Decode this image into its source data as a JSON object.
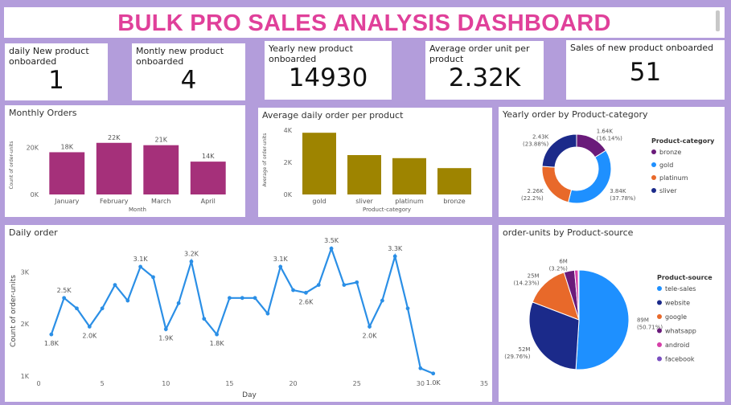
{
  "header": {
    "title": "BULK PRO SALES ANALYSIS DASHBOARD"
  },
  "kpis": [
    {
      "label": "daily New product onboarded",
      "value": "1"
    },
    {
      "label": "Montly new product onboarded",
      "value": "4"
    },
    {
      "label": "Yearly new product onboarded",
      "value": "14930"
    },
    {
      "label": "Average order unit per product",
      "value": "2.32K"
    },
    {
      "label": "Sales of new product onboarded",
      "value": "51"
    }
  ],
  "colors": {
    "title": "#e0409a",
    "monthly_bar": "#a5307a",
    "product_bar": "#9e8400",
    "line": "#2b8fe6",
    "bronze": "#6a1b7a",
    "gold": "#1e90ff",
    "platinum": "#e8692a",
    "sliver": "#1b2a8a",
    "tele-sales": "#1e90ff",
    "website": "#1b2a8a",
    "google": "#e8692a",
    "whatsapp": "#6a1b7a",
    "android": "#d63fa8",
    "facebook": "#7a4fc0"
  },
  "chart_data": [
    {
      "id": "monthly_orders",
      "type": "bar",
      "title": "Monthly Orders",
      "xlabel": "Month",
      "ylabel": "Count of order-units",
      "categories": [
        "January",
        "February",
        "March",
        "April"
      ],
      "values": [
        18000,
        22000,
        21000,
        14000
      ],
      "data_labels": [
        "18K",
        "22K",
        "21K",
        "14K"
      ],
      "yticks": [
        {
          "value": 0,
          "label": "0K"
        },
        {
          "value": 20000,
          "label": "20K"
        }
      ],
      "ylim": [
        0,
        25000
      ]
    },
    {
      "id": "avg_daily_order",
      "type": "bar",
      "title": "Average daily order per product",
      "xlabel": "Product-category",
      "ylabel": "Average of order-units",
      "categories": [
        "gold",
        "sliver",
        "platinum",
        "bronze"
      ],
      "values": [
        3840,
        2450,
        2260,
        1640
      ],
      "yticks": [
        {
          "value": 0,
          "label": "0K"
        },
        {
          "value": 2000,
          "label": "2K"
        },
        {
          "value": 4000,
          "label": "4K"
        }
      ],
      "ylim": [
        0,
        4300
      ]
    },
    {
      "id": "yearly_order_category",
      "type": "pie",
      "donut": true,
      "title": "Yearly order by Product-category",
      "legend_title": "Product-category",
      "legend_position": "right",
      "slices": [
        {
          "name": "bronze",
          "value": 1640,
          "label": "1.64K (16.14%)"
        },
        {
          "name": "gold",
          "value": 3840,
          "label": "3.84K (37.78%)"
        },
        {
          "name": "platinum",
          "value": 2260,
          "label": "2.26K (22.2%)"
        },
        {
          "name": "sliver",
          "value": 2430,
          "label": "2.43K (23.88%)"
        }
      ]
    },
    {
      "id": "daily_order",
      "type": "line",
      "title": "Daily order",
      "xlabel": "Day",
      "ylabel": "Count of order-units",
      "x": [
        1,
        2,
        3,
        4,
        5,
        6,
        7,
        8,
        9,
        10,
        11,
        12,
        13,
        14,
        15,
        16,
        17,
        18,
        19,
        20,
        21,
        22,
        23,
        24,
        25,
        26,
        27,
        28,
        29,
        30,
        31
      ],
      "y": [
        1800,
        2500,
        2300,
        1950,
        2300,
        2750,
        2450,
        3100,
        2900,
        1900,
        2400,
        3200,
        2100,
        1800,
        2500,
        2500,
        2500,
        2200,
        3100,
        2650,
        2600,
        2750,
        3450,
        2750,
        2800,
        1950,
        2450,
        3300,
        2300,
        1150,
        1050
      ],
      "data_labels": [
        {
          "index": 0,
          "text": "1.8K"
        },
        {
          "index": 1,
          "text": "2.5K"
        },
        {
          "index": 3,
          "text": "2.0K"
        },
        {
          "index": 7,
          "text": "3.1K"
        },
        {
          "index": 9,
          "text": "1.9K"
        },
        {
          "index": 11,
          "text": "3.2K"
        },
        {
          "index": 13,
          "text": "1.8K"
        },
        {
          "index": 18,
          "text": "3.1K"
        },
        {
          "index": 20,
          "text": "2.6K"
        },
        {
          "index": 22,
          "text": "3.5K"
        },
        {
          "index": 25,
          "text": "2.0K"
        },
        {
          "index": 27,
          "text": "3.3K"
        },
        {
          "index": 30,
          "text": "1.0K"
        }
      ],
      "xticks": [
        0,
        5,
        10,
        15,
        20,
        25,
        30,
        35
      ],
      "yticks": [
        {
          "value": 1000,
          "label": "1K"
        },
        {
          "value": 2000,
          "label": "2K"
        },
        {
          "value": 3000,
          "label": "3K"
        }
      ],
      "xlim": [
        0,
        35
      ],
      "ylim": [
        1000,
        3500
      ]
    },
    {
      "id": "order_units_source",
      "type": "pie",
      "title": "order-units by Product-source",
      "legend_title": "Product-source",
      "legend_position": "right",
      "slices": [
        {
          "name": "tele-sales",
          "value": 89,
          "label": "89M (50.71%)"
        },
        {
          "name": "website",
          "value": 52,
          "label": "52M (29.76%)"
        },
        {
          "name": "google",
          "value": 25,
          "label": "25M (14.23%)"
        },
        {
          "name": "whatsapp",
          "value": 6,
          "label": "6M (3.2%)"
        },
        {
          "name": "android",
          "value": 2,
          "label": ""
        },
        {
          "name": "facebook",
          "value": 0.5,
          "label": ""
        }
      ]
    }
  ]
}
